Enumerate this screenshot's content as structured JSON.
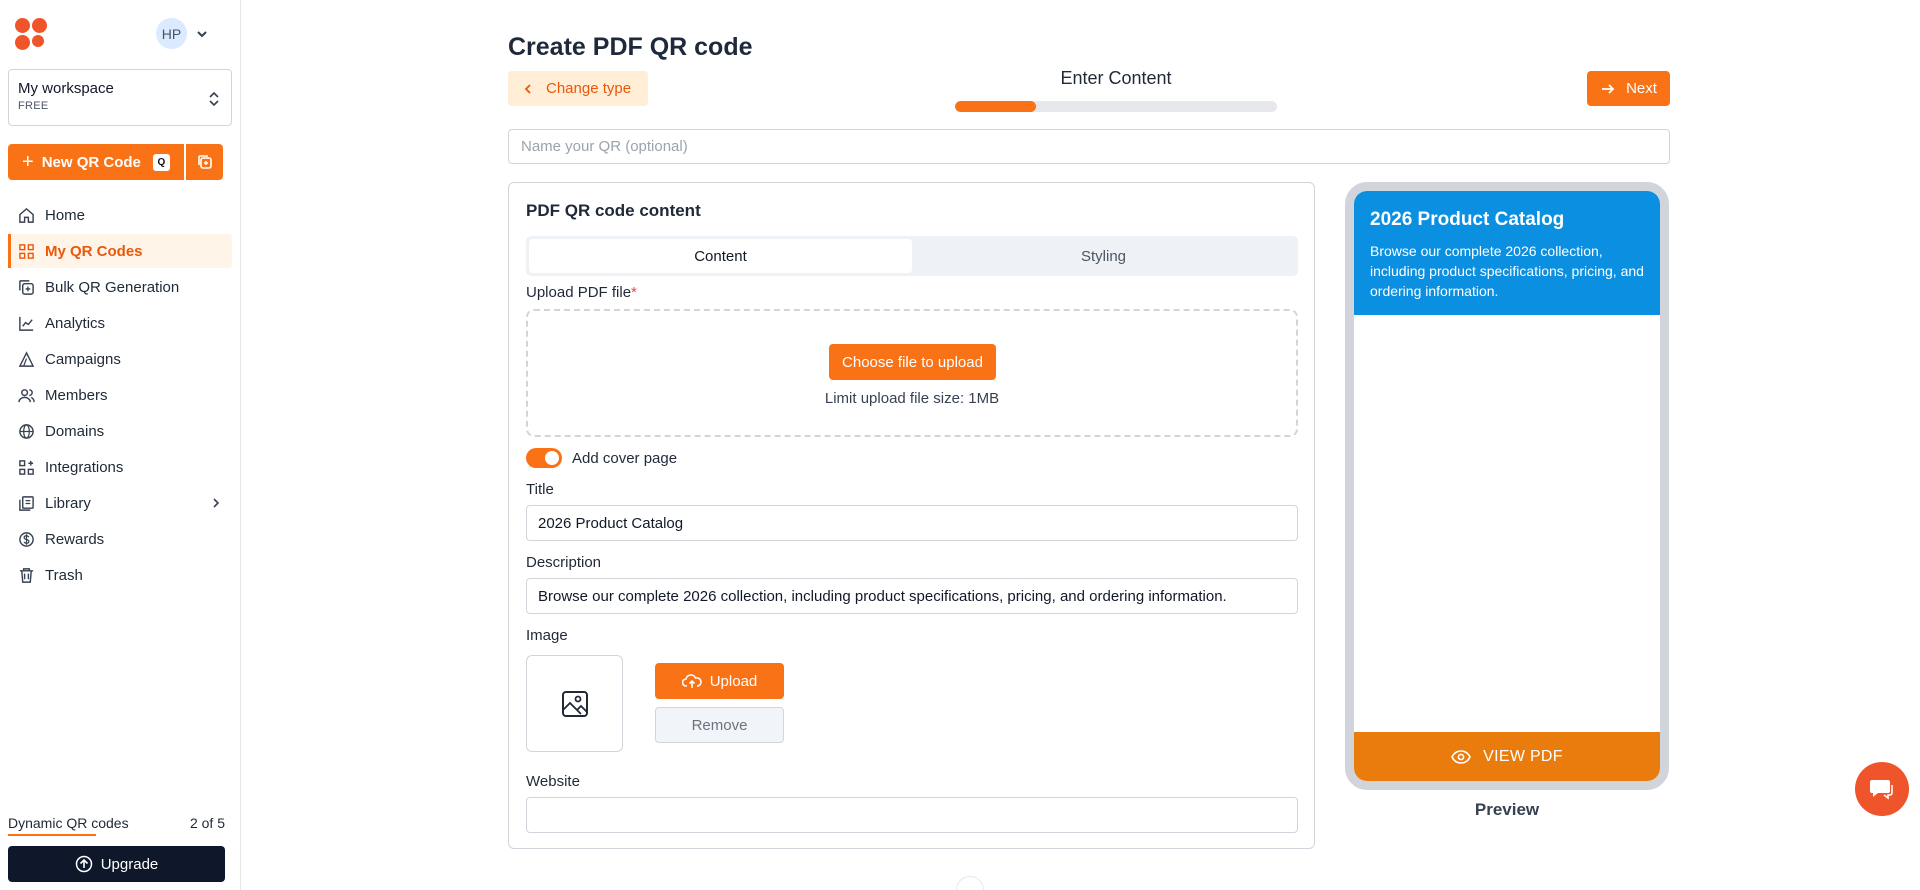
{
  "sidebar": {
    "avatar_initials": "HP",
    "workspace": {
      "name": "My workspace",
      "plan": "FREE"
    },
    "new_qr": {
      "label": "New QR Code",
      "shortcut": "Q"
    },
    "nav": [
      {
        "label": "Home",
        "icon": "home-icon"
      },
      {
        "label": "My QR Codes",
        "icon": "qr-grid-icon",
        "active": true
      },
      {
        "label": "Bulk QR Generation",
        "icon": "bulk-icon"
      },
      {
        "label": "Analytics",
        "icon": "analytics-icon"
      },
      {
        "label": "Campaigns",
        "icon": "campaign-icon"
      },
      {
        "label": "Members",
        "icon": "members-icon"
      },
      {
        "label": "Domains",
        "icon": "globe-icon"
      },
      {
        "label": "Integrations",
        "icon": "integrations-icon"
      },
      {
        "label": "Library",
        "icon": "library-icon"
      },
      {
        "label": "Rewards",
        "icon": "dollar-icon"
      },
      {
        "label": "Trash",
        "icon": "trash-icon"
      }
    ],
    "usage": {
      "label": "Dynamic QR codes",
      "value": "2 of 5"
    },
    "upgrade_label": "Upgrade"
  },
  "header": {
    "title": "Create PDF QR code",
    "change_type_label": "Change type",
    "step_label": "Enter Content",
    "step_progress": 0.25,
    "next_label": "Next"
  },
  "name_input": {
    "placeholder": "Name your QR (optional)",
    "value": ""
  },
  "form": {
    "card_title": "PDF QR code content",
    "tabs": [
      {
        "label": "Content",
        "active": true
      },
      {
        "label": "Styling",
        "active": false
      }
    ],
    "upload_label": "Upload PDF file",
    "required_mark": "*",
    "choose_file_label": "Choose file to upload",
    "limit_text": "Limit upload file size: 1MB",
    "cover_page_label": "Add cover page",
    "cover_page_on": true,
    "title_label": "Title",
    "title_value": "2026 Product Catalog",
    "description_label": "Description",
    "description_value": "Browse our complete 2026 collection, including product specifications, pricing, and ordering information.",
    "image_label": "Image",
    "upload_btn": "Upload",
    "remove_btn": "Remove",
    "website_label": "Website",
    "website_value": ""
  },
  "preview": {
    "title": "2026 Product Catalog",
    "description": "Browse our complete 2026 collection, including product specifications, pricing, and ordering information.",
    "header_color": "#0b8fe0",
    "button_label": "VIEW PDF",
    "button_color": "#e97c0c",
    "caption": "Preview"
  },
  "colors": {
    "accent": "#f97316"
  }
}
